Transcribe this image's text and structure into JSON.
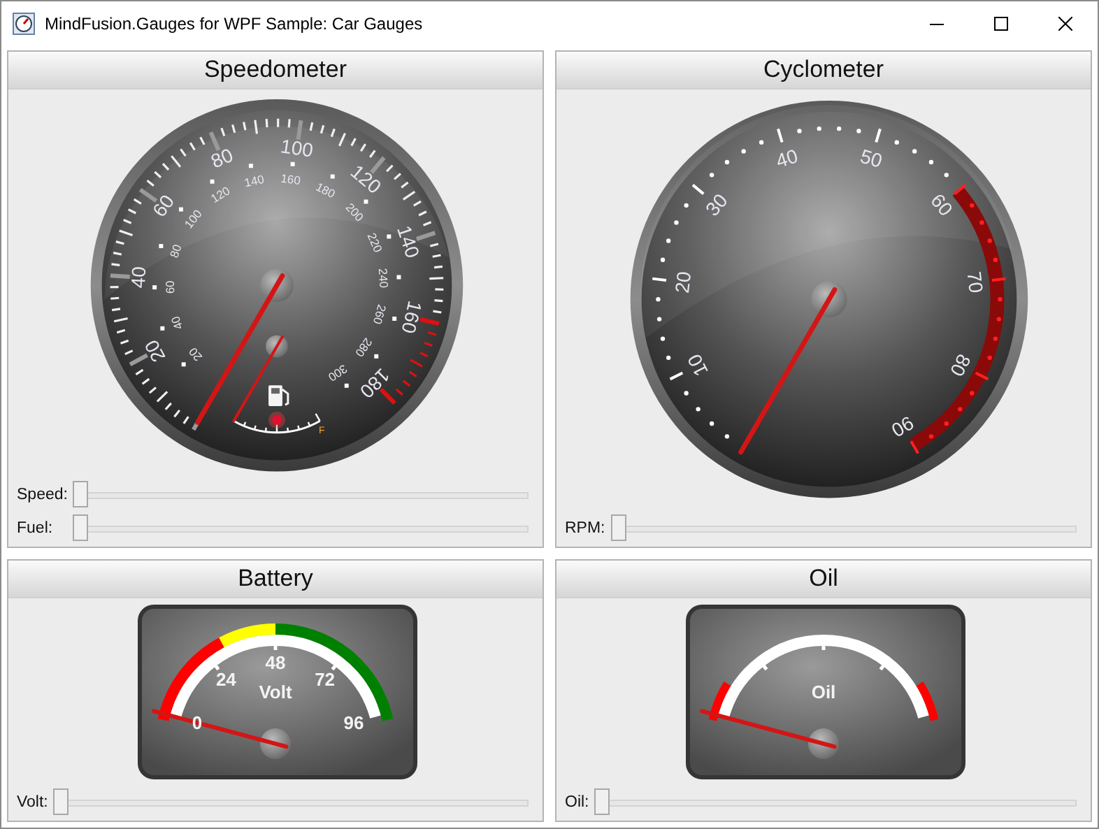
{
  "window": {
    "title": "MindFusion.Gauges for WPF Sample: Car Gauges"
  },
  "panels": [
    {
      "kind": "speedometer",
      "title": "Speedometer",
      "scale_labels": [
        "20",
        "40",
        "60",
        "80",
        "100",
        "120",
        "140",
        "160",
        "180"
      ],
      "inner_scale_labels": [
        "20",
        "40",
        "60",
        "80",
        "100",
        "120",
        "140",
        "160",
        "180",
        "200",
        "220",
        "240",
        "260",
        "280",
        "300"
      ],
      "fuel_labels": [
        "F"
      ],
      "sliders": [
        {
          "label": "Speed:",
          "level": 0
        },
        {
          "label": "Fuel:",
          "level": 0
        }
      ]
    },
    {
      "kind": "cyclometer",
      "title": "Cyclometer",
      "scale_labels": [
        "10",
        "20",
        "30",
        "40",
        "50",
        "60",
        "70",
        "80",
        "90"
      ],
      "sliders": [
        {
          "label": "RPM:",
          "level": 0
        }
      ]
    },
    {
      "kind": "battery",
      "title": "Battery",
      "scale_labels": [
        "0",
        "24",
        "48",
        "72",
        "96"
      ],
      "unit": "Volt",
      "sliders": [
        {
          "label": "Volt:",
          "level": 0
        }
      ]
    },
    {
      "kind": "oil",
      "title": "Oil",
      "unit": "Oil",
      "sliders": [
        {
          "label": "Oil:",
          "level": 0
        }
      ]
    }
  ]
}
